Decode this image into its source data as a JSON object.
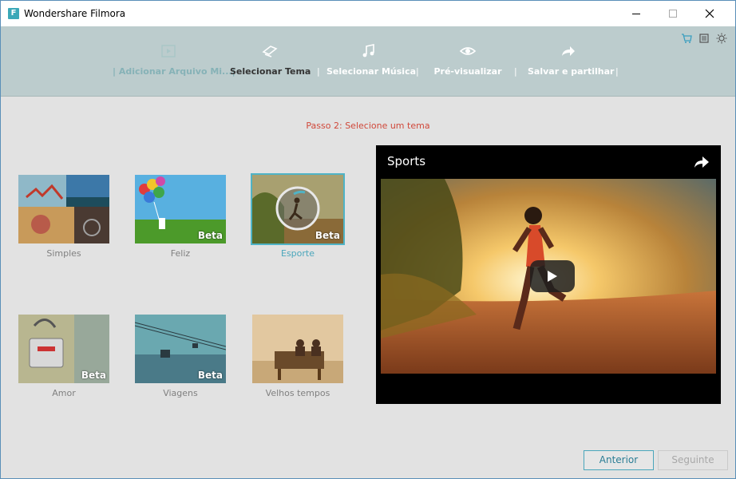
{
  "window": {
    "title": "Wondershare Filmora",
    "icon_letter": "F"
  },
  "steps": [
    {
      "label": "| Adicionar Arquivo Mi...|",
      "icon": "film-icon",
      "state": "done"
    },
    {
      "label": "Selecionar Tema",
      "icon": "theme-icon",
      "state": "active"
    },
    {
      "label": "Selecionar Música",
      "icon": "music-icon",
      "state": "pending"
    },
    {
      "label": "Pré-visualizar",
      "icon": "eye-icon",
      "state": "pending"
    },
    {
      "label": "Salvar e partilhar",
      "icon": "share-icon",
      "state": "pending"
    }
  ],
  "separators": [
    "|",
    "|",
    "|",
    "|"
  ],
  "utility_icons": [
    "cart-icon",
    "list-icon",
    "brightness-icon"
  ],
  "hint": "Passo 2: Selecione um tema",
  "themes": [
    {
      "label": "Simples",
      "beta": "",
      "selected": false
    },
    {
      "label": "Feliz",
      "beta": "Beta",
      "selected": false
    },
    {
      "label": "Esporte",
      "beta": "Beta",
      "selected": true
    },
    {
      "label": "Amor",
      "beta": "Beta",
      "selected": false
    },
    {
      "label": "Viagens",
      "beta": "Beta",
      "selected": false
    },
    {
      "label": "Velhos tempos",
      "beta": "",
      "selected": false
    }
  ],
  "preview": {
    "title": "Sports"
  },
  "buttons": {
    "previous": "Anterior",
    "next": "Seguinte"
  },
  "colors": {
    "accent": "#4aa6bb",
    "hint": "#d0483a",
    "header_bg": "#bccccd"
  }
}
